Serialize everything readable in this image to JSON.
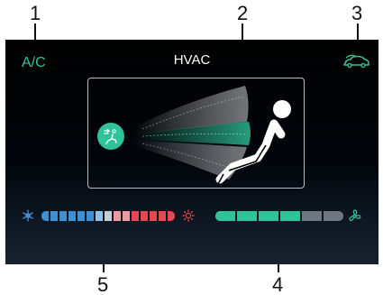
{
  "callouts": [
    "1",
    "2",
    "3",
    "4",
    "5"
  ],
  "header": {
    "ac_label": "A/C",
    "title": "HVAC"
  },
  "icons": {
    "car": "car-air-recirculation-icon",
    "airflow": "seat-airflow-icon",
    "seat": "seated-occupant-icon",
    "cool": "snowflake-icon",
    "heat": "sun-icon",
    "fan": "fan-icon"
  },
  "temperature_bar": {
    "segments": 15,
    "cool_color": "#3f8fd4",
    "cool_light": "#8ec0e8",
    "neutral_color": "#c8cdd3",
    "warm_light": "#e99aa2",
    "warm_color": "#e5484f",
    "selected_index": 7
  },
  "fan_bar": {
    "segments": 6,
    "level": 4,
    "active_color": "#2fc39a",
    "inactive_color": "#6e7680"
  },
  "colors": {
    "accent": "#2fc39a",
    "panel_border": "#b8bcc2"
  }
}
